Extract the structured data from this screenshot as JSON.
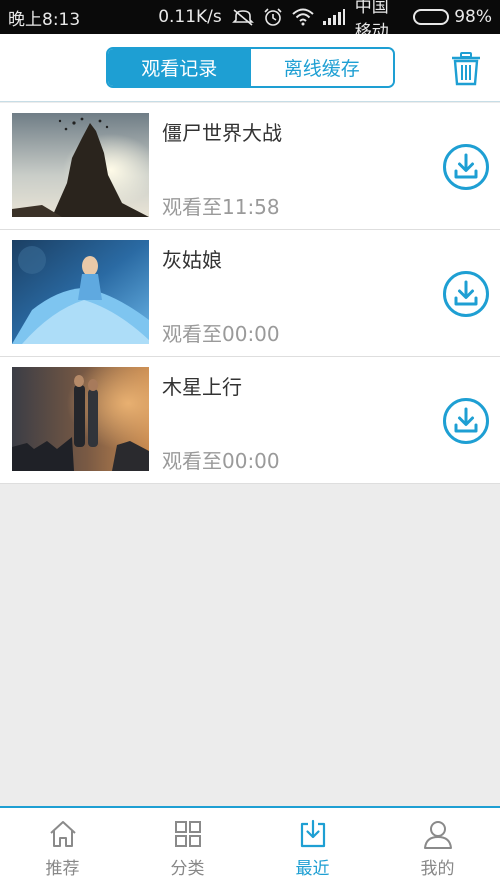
{
  "status_bar": {
    "time": "晚上8:13",
    "network_speed": "0.11K/s",
    "carrier": "中国移动",
    "battery": "98%",
    "battery_level": 0.98,
    "icons": [
      "mute-icon",
      "alarm-icon",
      "wifi-icon",
      "signal-icon",
      "battery-icon"
    ]
  },
  "header": {
    "tabs": [
      {
        "label": "观看记录",
        "active": true
      },
      {
        "label": "离线缓存",
        "active": false
      }
    ],
    "delete_icon": "trash-icon"
  },
  "history": [
    {
      "title": "僵尸世界大战",
      "progress": "观看至11:58"
    },
    {
      "title": "灰姑娘",
      "progress": "观看至00:00"
    },
    {
      "title": "木星上行",
      "progress": "观看至00:00"
    }
  ],
  "bottom_nav": [
    {
      "label": "推荐",
      "icon": "home-icon",
      "active": false
    },
    {
      "label": "分类",
      "icon": "grid-icon",
      "active": false
    },
    {
      "label": "最近",
      "icon": "download-box-icon",
      "active": true
    },
    {
      "label": "我的",
      "icon": "user-icon",
      "active": false
    }
  ],
  "colors": {
    "accent": "#1e9fd3",
    "status_bar": "#0a0a0a",
    "background": "#ececec",
    "text_primary": "#333333",
    "text_secondary": "#9a9a9a"
  }
}
